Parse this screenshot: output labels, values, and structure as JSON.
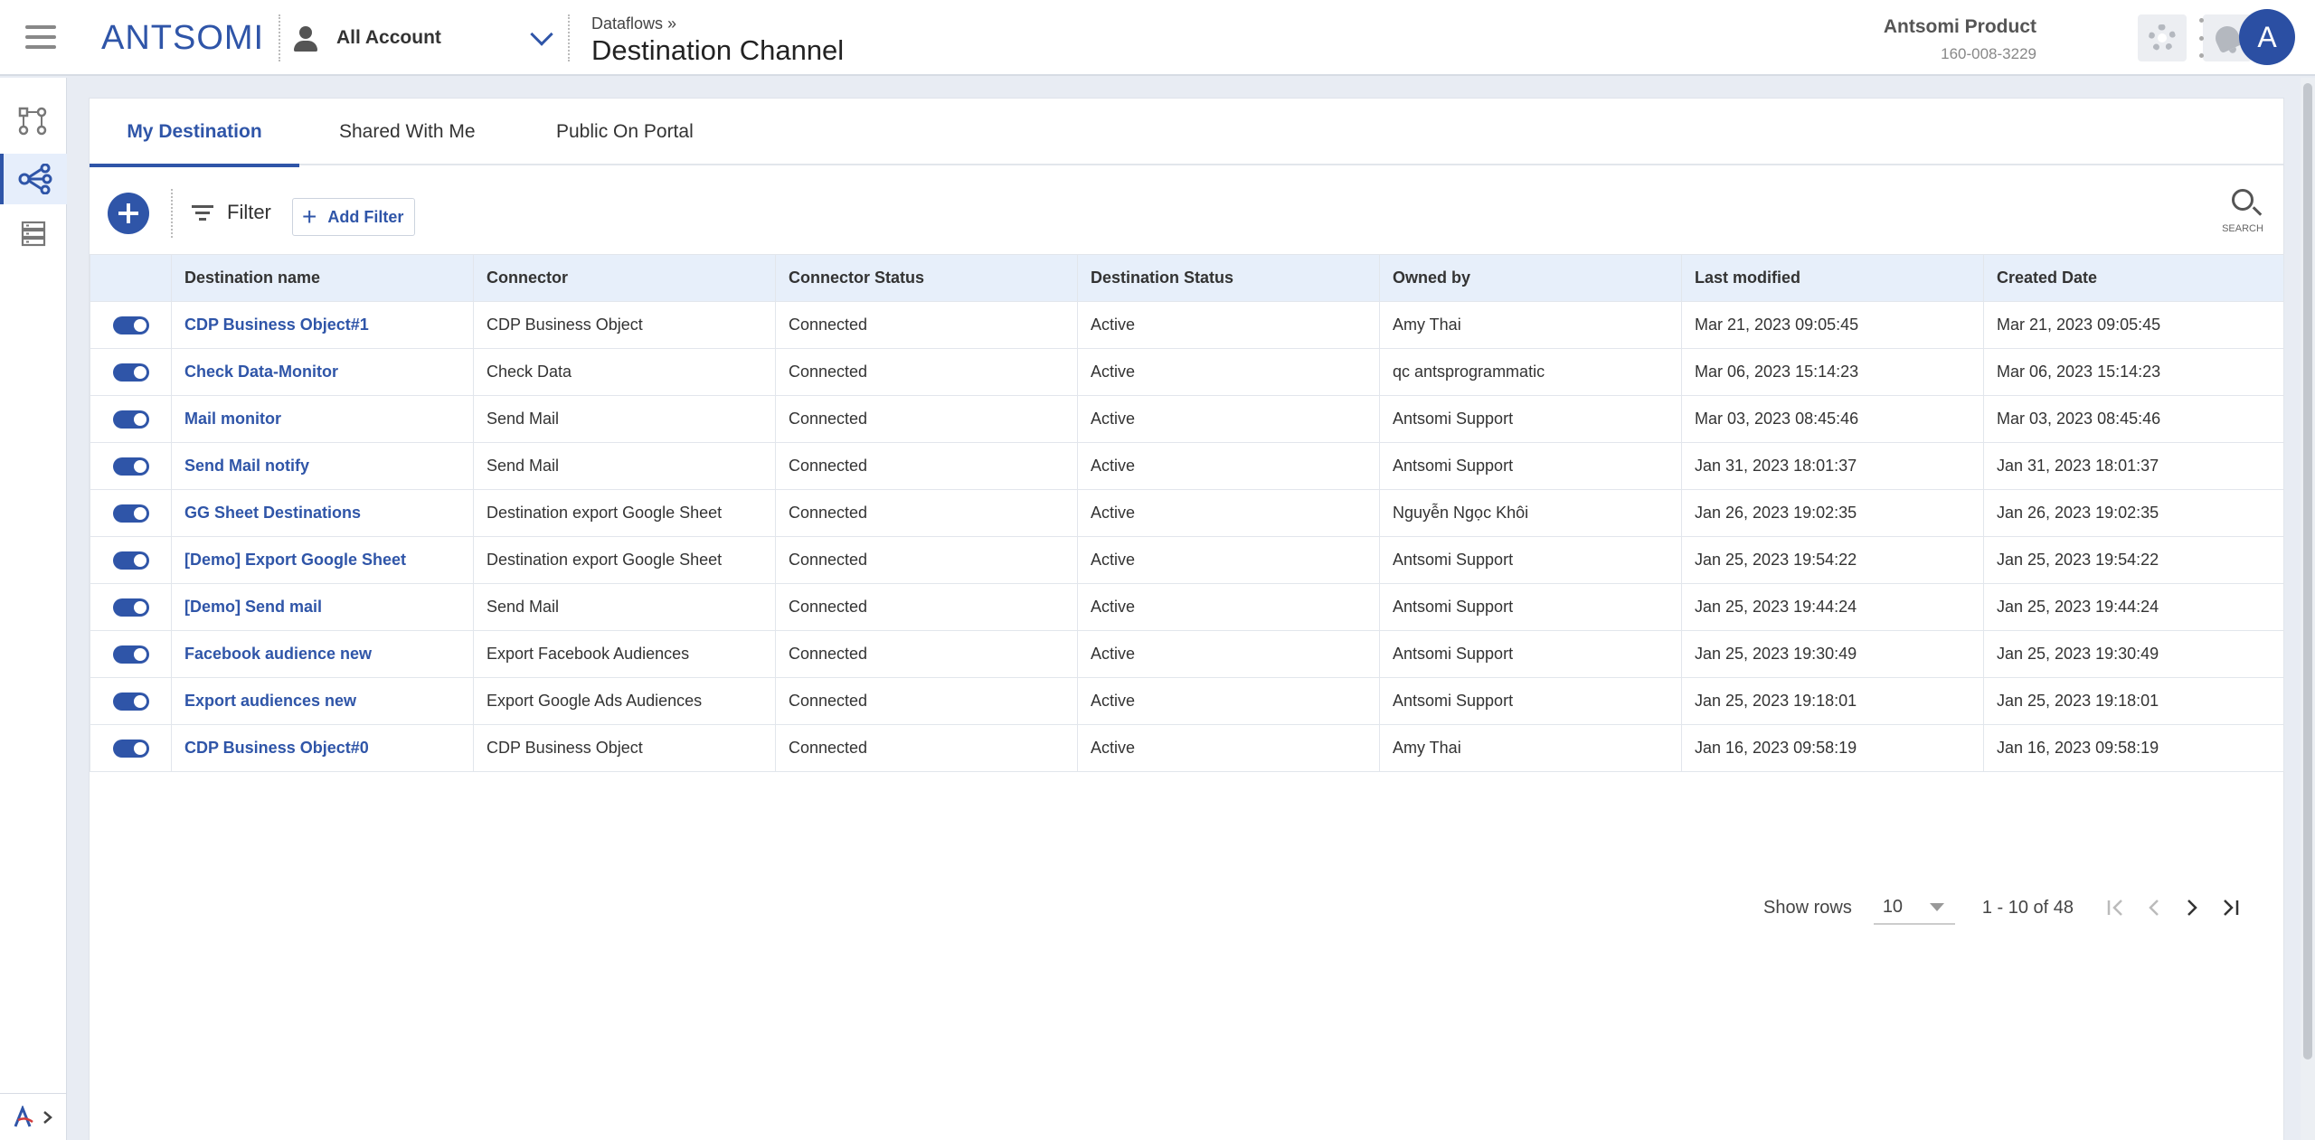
{
  "header": {
    "logo_text": "ANTSOMI",
    "account_label": "All Account",
    "breadcrumb": "Dataflows »",
    "title": "Destination Channel",
    "user_name": "Antsomi Product",
    "user_phone": "160-008-3229",
    "avatar_letter": "A"
  },
  "tabs": [
    {
      "label": "My Destination",
      "active": true
    },
    {
      "label": "Shared With Me",
      "active": false
    },
    {
      "label": "Public On Portal",
      "active": false
    }
  ],
  "toolbar": {
    "filter_label": "Filter",
    "add_filter_label": "Add Filter",
    "search_label": "SEARCH"
  },
  "table": {
    "columns": [
      "Destination name",
      "Connector",
      "Connector Status",
      "Destination Status",
      "Owned by",
      "Last modified",
      "Created Date"
    ],
    "rows": [
      {
        "enabled": true,
        "name": "CDP Business Object#1",
        "connector": "CDP Business Object",
        "connector_status": "Connected",
        "destination_status": "Active",
        "owner": "Amy Thai",
        "last_modified": "Mar 21, 2023 09:05:45",
        "created": "Mar 21, 2023 09:05:45"
      },
      {
        "enabled": true,
        "name": "Check Data-Monitor",
        "connector": "Check Data",
        "connector_status": "Connected",
        "destination_status": "Active",
        "owner": "qc antsprogrammatic",
        "last_modified": "Mar 06, 2023 15:14:23",
        "created": "Mar 06, 2023 15:14:23"
      },
      {
        "enabled": true,
        "name": "Mail monitor",
        "connector": "Send Mail",
        "connector_status": "Connected",
        "destination_status": "Active",
        "owner": "Antsomi Support",
        "last_modified": "Mar 03, 2023 08:45:46",
        "created": "Mar 03, 2023 08:45:46"
      },
      {
        "enabled": true,
        "name": "Send Mail notify",
        "connector": "Send Mail",
        "connector_status": "Connected",
        "destination_status": "Active",
        "owner": "Antsomi Support",
        "last_modified": "Jan 31, 2023 18:01:37",
        "created": "Jan 31, 2023 18:01:37"
      },
      {
        "enabled": true,
        "name": "GG Sheet Destinations",
        "connector": "Destination export Google Sheet",
        "connector_status": "Connected",
        "destination_status": "Active",
        "owner": "Nguyễn Ngọc Khôi",
        "last_modified": "Jan 26, 2023 19:02:35",
        "created": "Jan 26, 2023 19:02:35"
      },
      {
        "enabled": true,
        "name": "[Demo] Export Google Sheet",
        "connector": "Destination export Google Sheet",
        "connector_status": "Connected",
        "destination_status": "Active",
        "owner": "Antsomi Support",
        "last_modified": "Jan 25, 2023 19:54:22",
        "created": "Jan 25, 2023 19:54:22"
      },
      {
        "enabled": true,
        "name": "[Demo] Send mail",
        "connector": "Send Mail",
        "connector_status": "Connected",
        "destination_status": "Active",
        "owner": "Antsomi Support",
        "last_modified": "Jan 25, 2023 19:44:24",
        "created": "Jan 25, 2023 19:44:24"
      },
      {
        "enabled": true,
        "name": "Facebook audience new",
        "connector": "Export Facebook Audiences",
        "connector_status": "Connected",
        "destination_status": "Active",
        "owner": "Antsomi Support",
        "last_modified": "Jan 25, 2023 19:30:49",
        "created": "Jan 25, 2023 19:30:49"
      },
      {
        "enabled": true,
        "name": "Export audiences new",
        "connector": "Export Google Ads Audiences",
        "connector_status": "Connected",
        "destination_status": "Active",
        "owner": "Antsomi Support",
        "last_modified": "Jan 25, 2023 19:18:01",
        "created": "Jan 25, 2023 19:18:01"
      },
      {
        "enabled": true,
        "name": "CDP Business Object#0",
        "connector": "CDP Business Object",
        "connector_status": "Connected",
        "destination_status": "Active",
        "owner": "Amy Thai",
        "last_modified": "Jan 16, 2023 09:58:19",
        "created": "Jan 16, 2023 09:58:19"
      }
    ]
  },
  "pagination": {
    "show_rows_label": "Show rows",
    "rows_per_page": "10",
    "range_text": "1 - 10 of 48"
  },
  "colors": {
    "accent": "#2f55a8",
    "header_row_bg": "#e7effa"
  }
}
